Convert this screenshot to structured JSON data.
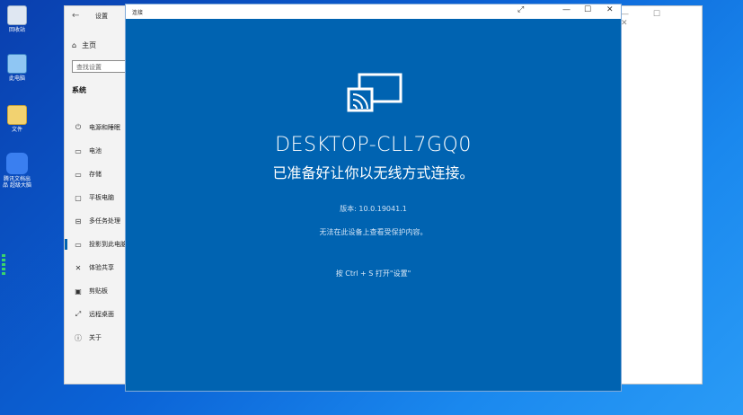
{
  "desktop": {
    "icons": [
      {
        "label": "回收站",
        "icon": "recycle-bin-icon"
      },
      {
        "label": "此电脑",
        "icon": "computer-icon"
      },
      {
        "label": "文件",
        "icon": "folder-icon"
      },
      {
        "label": "腾讯文档出品 超级大脑",
        "icon": "owl-app-icon"
      }
    ]
  },
  "settings": {
    "title": "设置",
    "home_label": "主页",
    "search_placeholder": "查找设置",
    "section": "系统",
    "items": [
      {
        "label": "电源和睡眠",
        "icon": "power-icon"
      },
      {
        "label": "电池",
        "icon": "battery-icon"
      },
      {
        "label": "存储",
        "icon": "storage-icon"
      },
      {
        "label": "平板电脑",
        "icon": "tablet-icon"
      },
      {
        "label": "多任务处理",
        "icon": "multitask-icon"
      },
      {
        "label": "投影到此电脑",
        "icon": "project-icon"
      },
      {
        "label": "体验共享",
        "icon": "share-icon"
      },
      {
        "label": "剪贴板",
        "icon": "clipboard-icon"
      },
      {
        "label": "远程桌面",
        "icon": "remote-icon"
      },
      {
        "label": "关于",
        "icon": "info-icon"
      }
    ]
  },
  "connect": {
    "title": "连接",
    "device_name": "DESKTOP-CLL7GQ0",
    "ready_text": "已准备好让你以无线方式连接。",
    "version": "版本: 10.0.19041.1",
    "protected_note": "无法在此设备上查看受保护内容。",
    "shortcut": "按 Ctrl + S 打开\"设置\""
  },
  "colors": {
    "accent": "#0063b1"
  }
}
